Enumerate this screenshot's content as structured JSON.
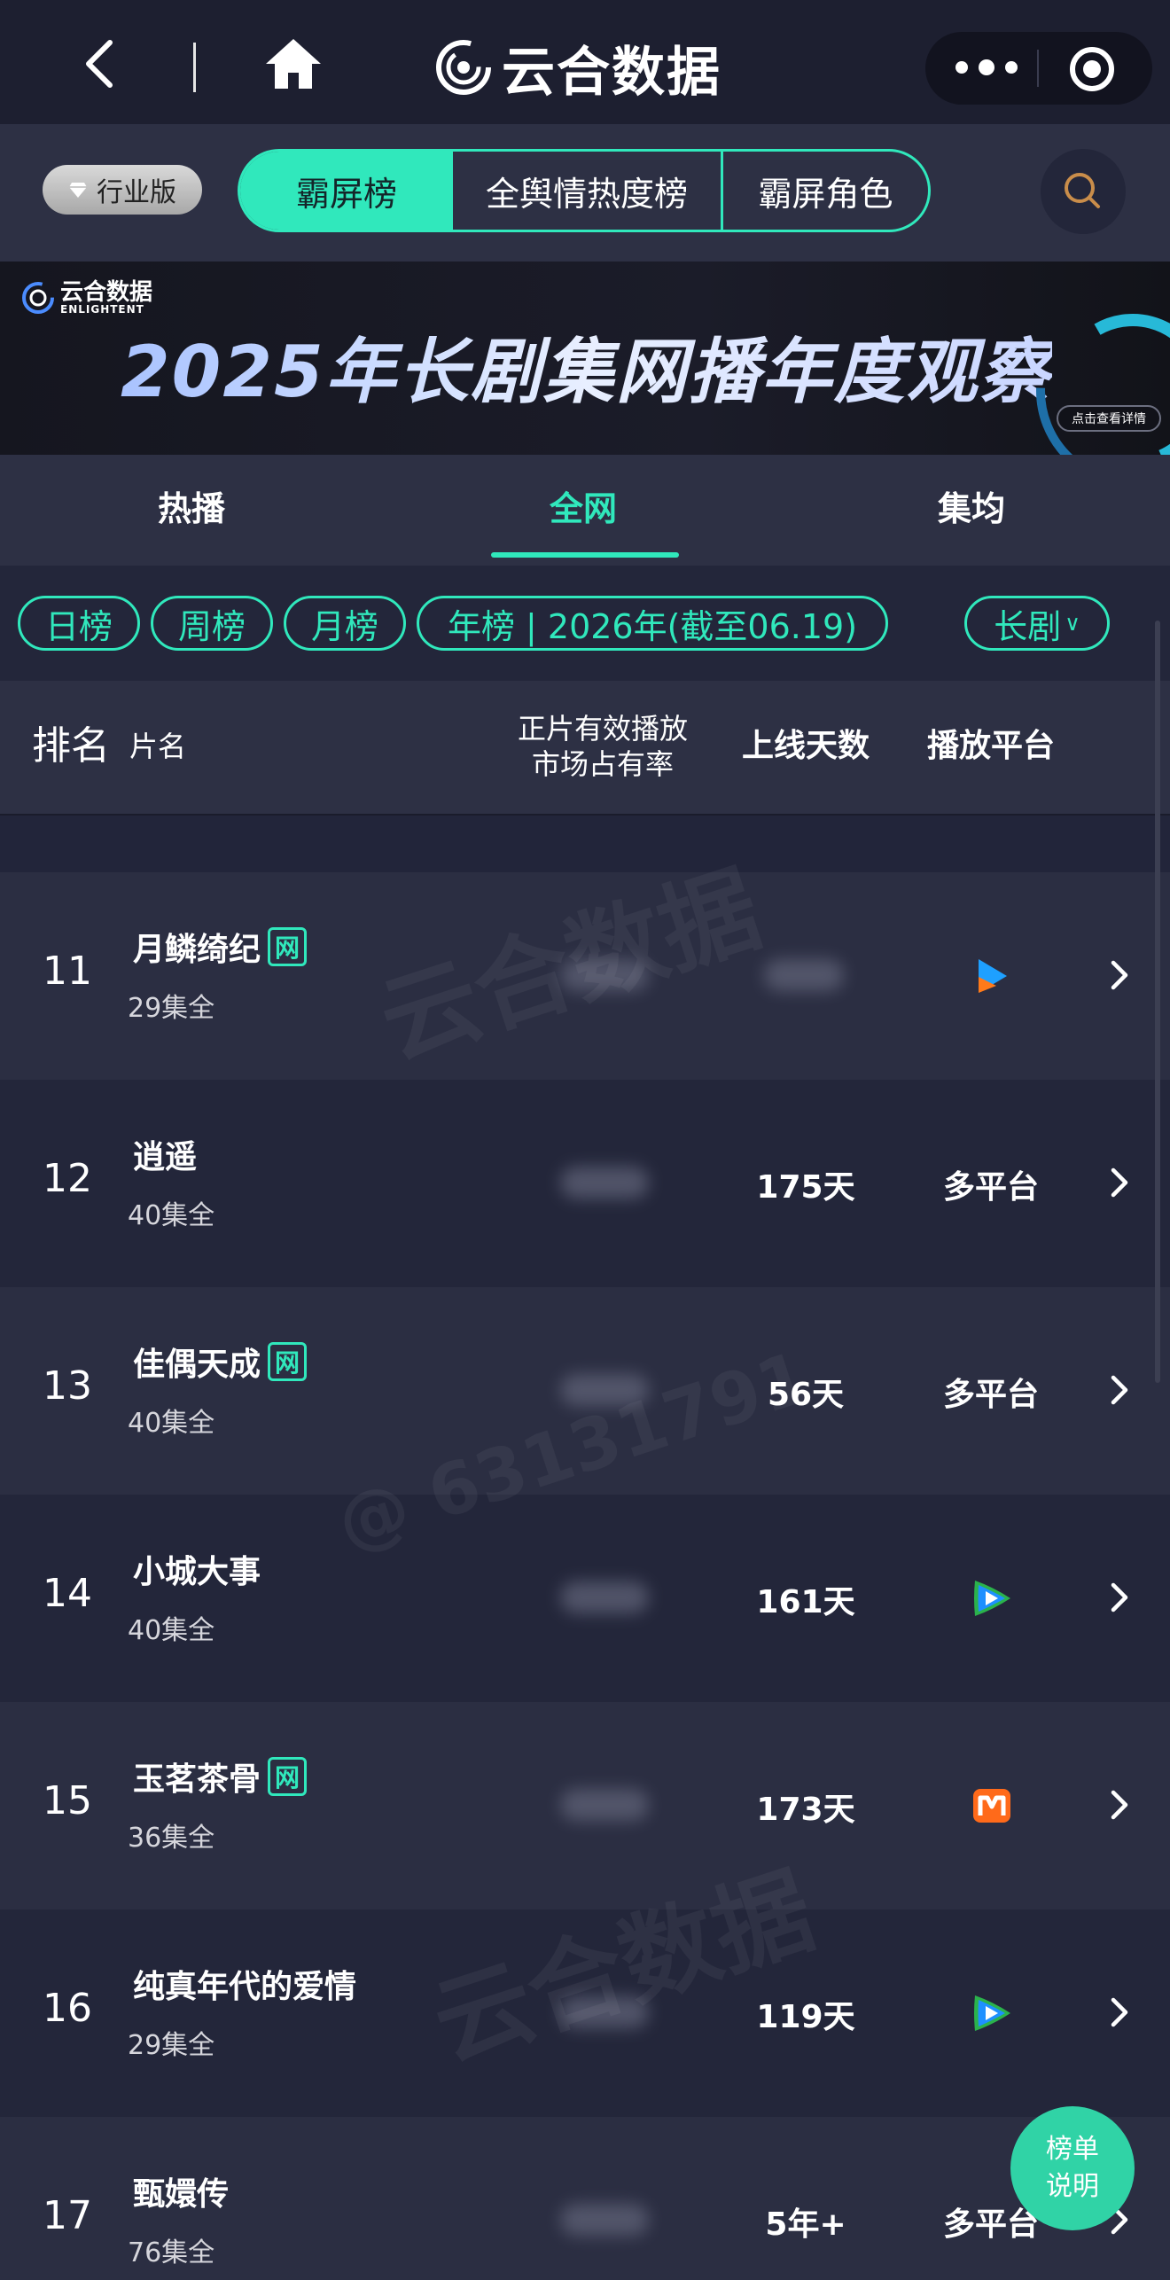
{
  "topbar": {
    "brand_name": "云合数据"
  },
  "tabs": {
    "badge": "行业版",
    "segments": [
      "霸屏榜",
      "全舆情热度榜",
      "霸屏角色"
    ],
    "active": 0
  },
  "banner": {
    "brand_cn": "云合数据",
    "brand_en": "ENLIGHTENT",
    "title": "2025年长剧集网播年度观察",
    "cta": "点击查看详情"
  },
  "subtabs": [
    "热播",
    "全网",
    "集均"
  ],
  "filters": {
    "chips": [
      "日榜",
      "周榜",
      "月榜",
      "年榜 | 2026年(截至06.19)"
    ],
    "genre": "长剧"
  },
  "table": {
    "headers": {
      "rank": "排名",
      "name": "片名",
      "share_line1": "正片有效播放",
      "share_line2": "市场占有率",
      "days": "上线天数",
      "platform": "播放平台"
    },
    "net_tag": "网",
    "rows": [
      {
        "rank": "11",
        "title": "月鳞绮纪",
        "net": true,
        "episodes": "29集全",
        "days": "",
        "platform": "",
        "platform_icon": "youku-icon"
      },
      {
        "rank": "12",
        "title": "逍遥",
        "net": false,
        "episodes": "40集全",
        "days": "175天",
        "platform": "多平台",
        "platform_icon": ""
      },
      {
        "rank": "13",
        "title": "佳偶天成",
        "net": true,
        "episodes": "40集全",
        "days": "56天",
        "platform": "多平台",
        "platform_icon": ""
      },
      {
        "rank": "14",
        "title": "小城大事",
        "net": false,
        "episodes": "40集全",
        "days": "161天",
        "platform": "",
        "platform_icon": "tencent-video-icon"
      },
      {
        "rank": "15",
        "title": "玉茗茶骨",
        "net": true,
        "episodes": "36集全",
        "days": "173天",
        "platform": "",
        "platform_icon": "mango-tv-icon"
      },
      {
        "rank": "16",
        "title": "纯真年代的爱情",
        "net": false,
        "episodes": "29集全",
        "days": "119天",
        "platform": "",
        "platform_icon": "tencent-video-icon"
      },
      {
        "rank": "17",
        "title": "甄嬛传",
        "net": false,
        "episodes": "76集全",
        "days": "5年+",
        "platform": "多平台",
        "platform_icon": ""
      }
    ]
  },
  "float_button": [
    "榜单",
    "说明"
  ],
  "colors": {
    "accent": "#30e8bc",
    "background": "#23263a",
    "row_alt": "#2b2e42",
    "header": "#2d3044"
  }
}
